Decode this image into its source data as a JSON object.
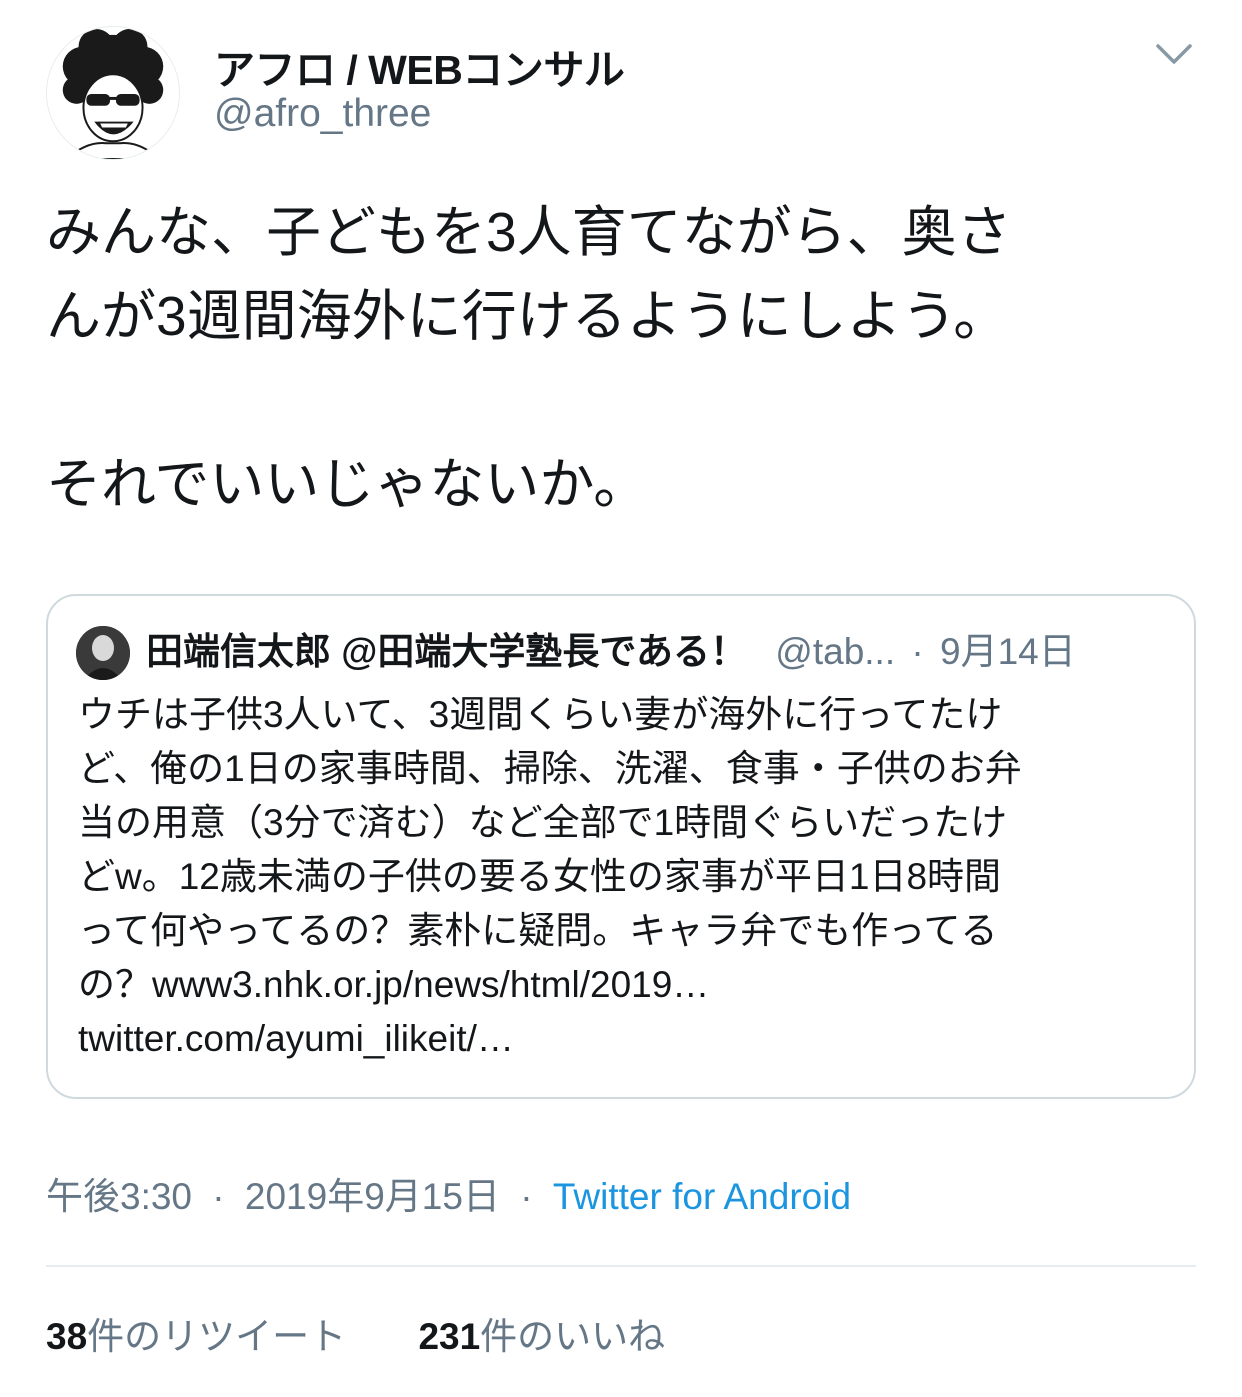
{
  "author": {
    "display_name": "アフロ / WEBコンサル",
    "handle": "@afro_three",
    "avatar_icon": "afro-cartoon-avatar"
  },
  "menu_icon": "chevron-down-icon",
  "tweet": {
    "lines": [
      "みんな、子どもを3人育てながら、奥さ",
      "んが3週間海外に行けるようにしよう。",
      "",
      "それでいいじゃないか。"
    ]
  },
  "quoted": {
    "name": "田端信太郎 @田端大学塾長である！",
    "handle": "@tab...",
    "date": "9月14日",
    "separator": "·",
    "lines": [
      "ウチは子供3人いて、3週間くらい妻が海外に行ってたけ",
      "ど、俺の1日の家事時間、掃除、洗濯、食事・子供のお弁",
      "当の用意（3分で済む）など全部で1時間ぐらいだったけ",
      "どw。12歳未満の子供の要る女性の家事が平日1日8時間",
      "って何やってるの？素朴に疑問。キャラ弁でも作ってる",
      "の？www3.nhk.or.jp/news/html/2019…",
      "twitter.com/ayumi_ilikeit/…"
    ]
  },
  "meta": {
    "time": "午後3:30",
    "date": "2019年9月15日",
    "separator": "·",
    "source": "Twitter for Android"
  },
  "stats": {
    "retweets_count": "38",
    "retweets_label": "件のリツイート",
    "likes_count": "231",
    "likes_label": "件のいいね"
  },
  "colors": {
    "text": "#14171a",
    "secondary": "#657786",
    "link": "#1b95e0",
    "border": "#cfd9de"
  }
}
